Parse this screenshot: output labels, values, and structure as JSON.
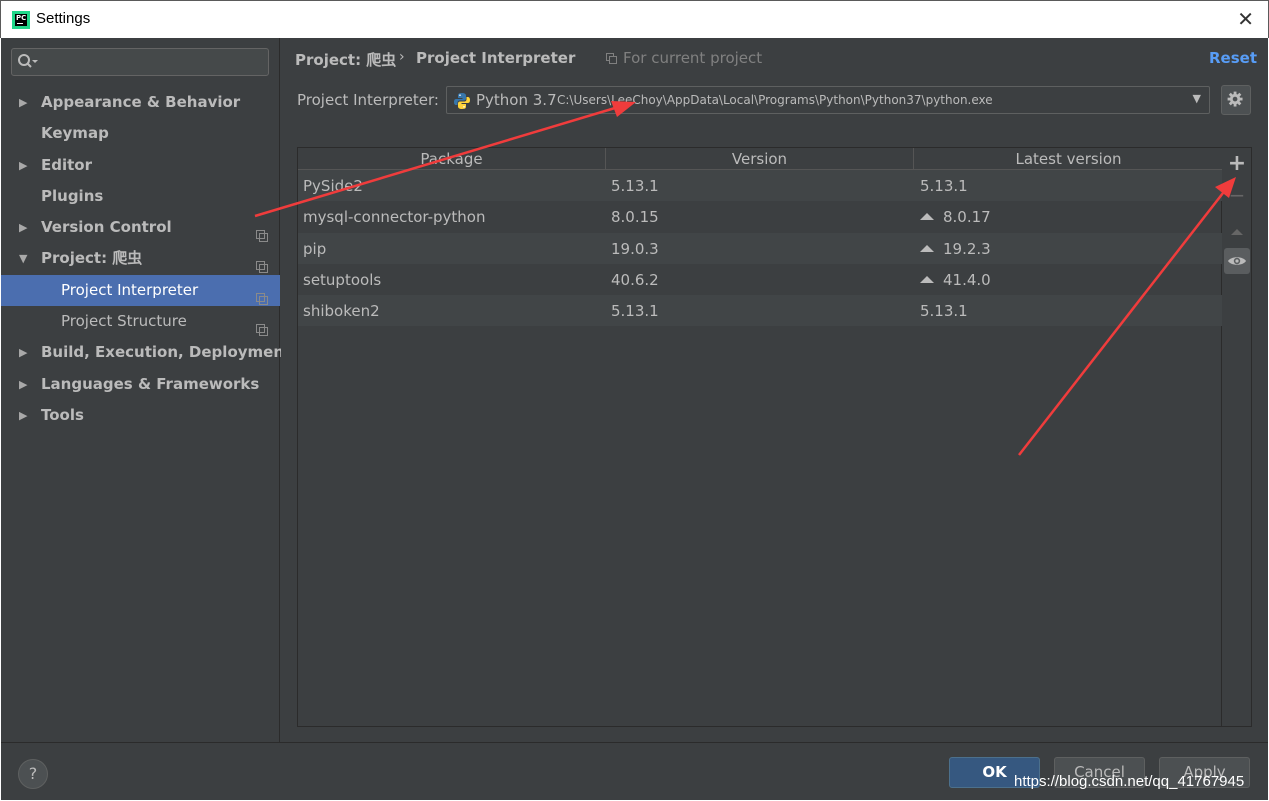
{
  "window": {
    "title": "Settings"
  },
  "search": {
    "placeholder": ""
  },
  "sidebar": {
    "items": [
      {
        "label": "Appearance & Behavior",
        "expander": "collapsed"
      },
      {
        "label": "Keymap",
        "expander": "none"
      },
      {
        "label": "Editor",
        "expander": "collapsed"
      },
      {
        "label": "Plugins",
        "expander": "none"
      },
      {
        "label": "Version Control",
        "expander": "collapsed"
      },
      {
        "label": "Project: 爬虫",
        "expander": "expanded"
      },
      {
        "label": "Project Interpreter",
        "child": true,
        "selected": true
      },
      {
        "label": "Project Structure",
        "child": true
      },
      {
        "label": "Build, Execution, Deployment",
        "expander": "collapsed"
      },
      {
        "label": "Languages & Frameworks",
        "expander": "collapsed"
      },
      {
        "label": "Tools",
        "expander": "collapsed"
      }
    ]
  },
  "header": {
    "breadcrumb_parent": "Project: 爬虫",
    "breadcrumb_separator": "›",
    "breadcrumb_current": "Project Interpreter",
    "scope": "For current project",
    "reset": "Reset"
  },
  "interpreter": {
    "label": "Project Interpreter:",
    "name": "Python 3.7",
    "path": "C:\\Users\\LeeChoy\\AppData\\Local\\Programs\\Python\\Python37\\python.exe"
  },
  "table": {
    "columns": [
      "Package",
      "Version",
      "Latest version"
    ],
    "rows": [
      {
        "package": "PySide2",
        "version": "5.13.1",
        "latest": "5.13.1",
        "upgrade": false
      },
      {
        "package": "mysql-connector-python",
        "version": "8.0.15",
        "latest": "8.0.17",
        "upgrade": true
      },
      {
        "package": "pip",
        "version": "19.0.3",
        "latest": "19.2.3",
        "upgrade": true
      },
      {
        "package": "setuptools",
        "version": "40.6.2",
        "latest": "41.4.0",
        "upgrade": true
      },
      {
        "package": "shiboken2",
        "version": "5.13.1",
        "latest": "5.13.1",
        "upgrade": false
      }
    ]
  },
  "tools": {
    "add": "+",
    "remove": "−"
  },
  "footer": {
    "help": "?",
    "ok": "OK",
    "cancel": "Cancel",
    "apply": "Apply",
    "watermark": "https://blog.csdn.net/qq_41767945"
  },
  "colors": {
    "background": "#3c3f41",
    "selection": "#4b6eaf",
    "accent_link": "#589df6",
    "ok_button": "#365880",
    "annotation_arrow": "#f03c3c"
  }
}
